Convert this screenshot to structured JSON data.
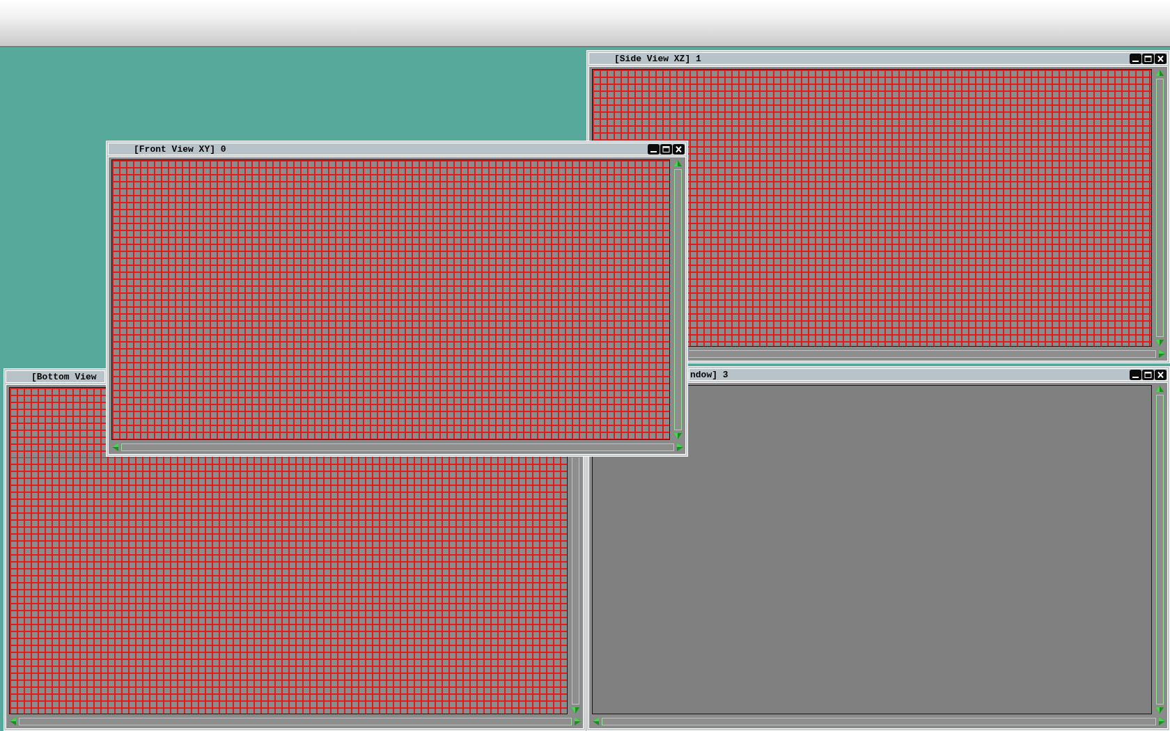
{
  "desktop": {
    "windows": [
      {
        "title": "[Side View XZ] 1",
        "kind": "grid",
        "controls": [
          {
            "kind": "minimize"
          },
          {
            "kind": "maximize"
          },
          {
            "kind": "close"
          }
        ],
        "scroll_arrows": [
          {
            "kind": "up"
          },
          {
            "kind": "down"
          },
          {
            "kind": "right"
          }
        ]
      },
      {
        "title": "[Front View XY] 0",
        "kind": "grid",
        "controls": [
          {
            "kind": "minimize"
          },
          {
            "kind": "maximize"
          },
          {
            "kind": "close"
          }
        ],
        "scroll_arrows": [
          {
            "kind": "up"
          },
          {
            "kind": "down"
          },
          {
            "kind": "left"
          },
          {
            "kind": "right"
          }
        ]
      },
      {
        "title": "[Bottom View",
        "kind": "grid",
        "scroll_arrows": [
          {
            "kind": "down"
          },
          {
            "kind": "left"
          },
          {
            "kind": "right"
          }
        ]
      },
      {
        "title": "ndow] 3",
        "kind": "blank",
        "controls": [
          {
            "kind": "minimize"
          },
          {
            "kind": "maximize"
          },
          {
            "kind": "close"
          }
        ],
        "scroll_arrows": [
          {
            "kind": "up"
          },
          {
            "kind": "down"
          },
          {
            "kind": "left"
          },
          {
            "kind": "right"
          }
        ]
      }
    ]
  }
}
